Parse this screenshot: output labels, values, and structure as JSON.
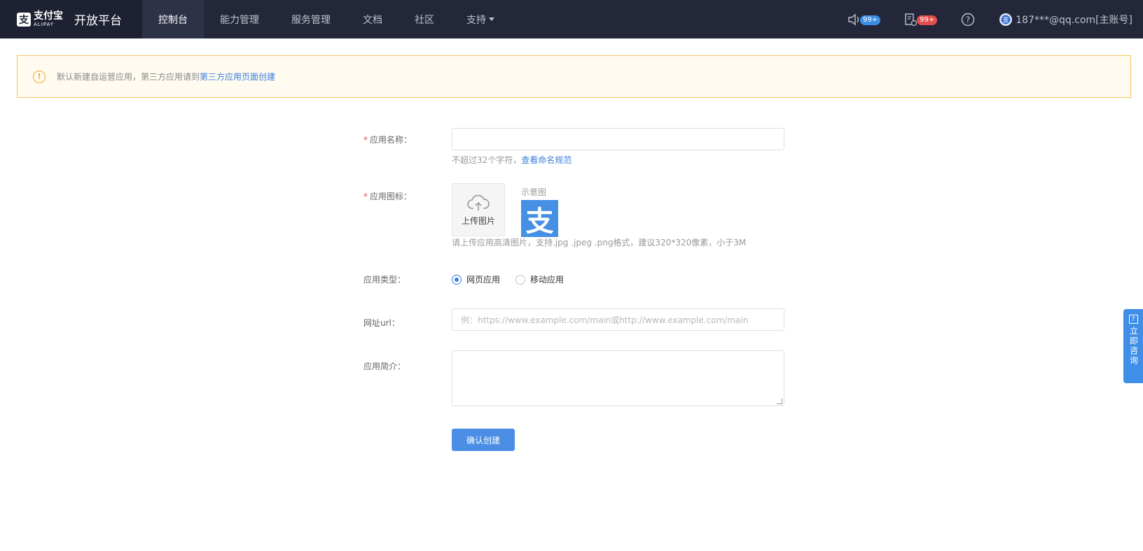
{
  "header": {
    "logo_cn": "支付宝",
    "logo_en": "ALIPAY",
    "brand_title": "开放平台",
    "nav": [
      {
        "label": "控制台",
        "active": true
      },
      {
        "label": "能力管理"
      },
      {
        "label": "服务管理"
      },
      {
        "label": "文档"
      },
      {
        "label": "社区"
      },
      {
        "label": "支持"
      }
    ],
    "notify_badge": "99+",
    "message_badge": "99+",
    "account": "187***@qq.com[主账号]"
  },
  "alert": {
    "text": "默认新建自运营应用，第三方应用请到",
    "link": "第三方应用页面创建"
  },
  "form": {
    "name_label": "应用名称：",
    "name_hint": "不超过32个字符，",
    "name_hint_link": "查看命名规范",
    "icon_label": "应用图标：",
    "upload_label": "上传图片",
    "sample_label": "示意图",
    "sample_glyph": "支",
    "icon_hint": "请上传应用高清图片，支持.jpg .jpeg .png格式，建议320*320像素，小于3M",
    "type_label": "应用类型：",
    "type_options": [
      "网页应用",
      "移动应用"
    ],
    "type_selected": "网页应用",
    "url_label": "网址url：",
    "url_placeholder": "例：https://www.example.com/main或http://www.example.com/main",
    "desc_label": "应用简介：",
    "submit": "确认创建"
  },
  "consult": {
    "text": "立即咨询"
  },
  "colors": {
    "topbar": "#232739",
    "accent": "#4a8ee6",
    "alert_border": "#f6c35c"
  }
}
